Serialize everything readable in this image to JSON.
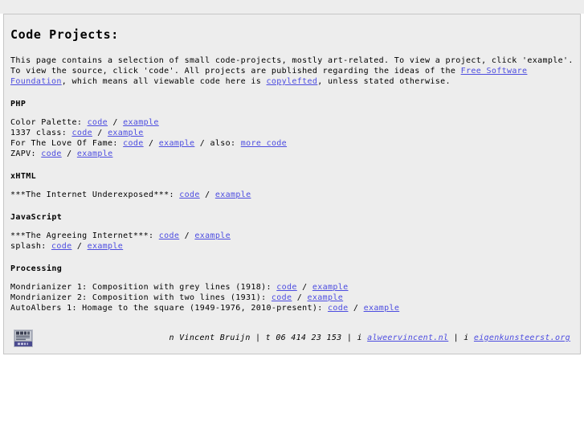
{
  "page": {
    "title": "Code Projects:",
    "intro_parts": {
      "before_copyleft_1": "This page contains a selection of small code-projects, mostly art-related. To view a project, click 'example'. To view the source, click 'code'. All projects are published regarding the ideas of the ",
      "fsf_link": "Free Software Foundation",
      "middle": ", which means all viewable code here is ",
      "copyleft_link": "copylefted",
      "after": ", unless stated otherwise."
    }
  },
  "sections": [
    {
      "heading": "PHP",
      "items": [
        {
          "label": "Color Palette:",
          "links": [
            "code",
            "example"
          ],
          "extra_label": "",
          "extra_link": ""
        },
        {
          "label": "1337 class:",
          "links": [
            "code",
            "example"
          ],
          "extra_label": "",
          "extra_link": ""
        },
        {
          "label": "For The Love Of Fame:",
          "links": [
            "code",
            "example"
          ],
          "extra_label": "also:",
          "extra_link": "more code"
        },
        {
          "label": "ZAPV:",
          "links": [
            "code",
            "example"
          ],
          "extra_label": "",
          "extra_link": ""
        }
      ]
    },
    {
      "heading": "xHTML",
      "items": [
        {
          "label": "***The Internet Underexposed***:",
          "links": [
            "code",
            "example"
          ],
          "extra_label": "",
          "extra_link": ""
        }
      ]
    },
    {
      "heading": "JavaScript",
      "items": [
        {
          "label": "***The Agreeing Internet***:",
          "links": [
            "code",
            "example"
          ],
          "extra_label": "",
          "extra_link": ""
        },
        {
          "label": "splash:",
          "links": [
            "code",
            "example"
          ],
          "extra_label": "",
          "extra_link": ""
        }
      ]
    },
    {
      "heading": "Processing",
      "items": [
        {
          "label": "Mondrianizer 1: Composition with grey lines (1918):",
          "links": [
            "code",
            "example"
          ],
          "extra_label": "",
          "extra_link": ""
        },
        {
          "label": "Mondrianizer 2: Composition with two lines (1931):",
          "links": [
            "code",
            "example"
          ],
          "extra_label": "",
          "extra_link": ""
        },
        {
          "label": "AutoAlbers 1: Homage to the square (1949-1976, 2010-present):",
          "links": [
            "code",
            "example"
          ],
          "extra_label": "",
          "extra_link": ""
        }
      ]
    }
  ],
  "footer": {
    "badge_name": "zend-certified-badge",
    "badge_top_text": "zend",
    "badge_bottom_text": "PHP 5",
    "name_prefix": "n",
    "name": "Vincent Bruijn",
    "tel_prefix": "t",
    "tel": "06 414 23 153",
    "site1_prefix": "i",
    "site1": "alweervincent.nl",
    "site2_prefix": "i",
    "site2": "eigenkunsteerst.org",
    "separator": "|"
  },
  "colors": {
    "link": "#4c4ce0",
    "page_bg": "#ededed",
    "border": "#c6c6c6",
    "text": "#000000"
  }
}
